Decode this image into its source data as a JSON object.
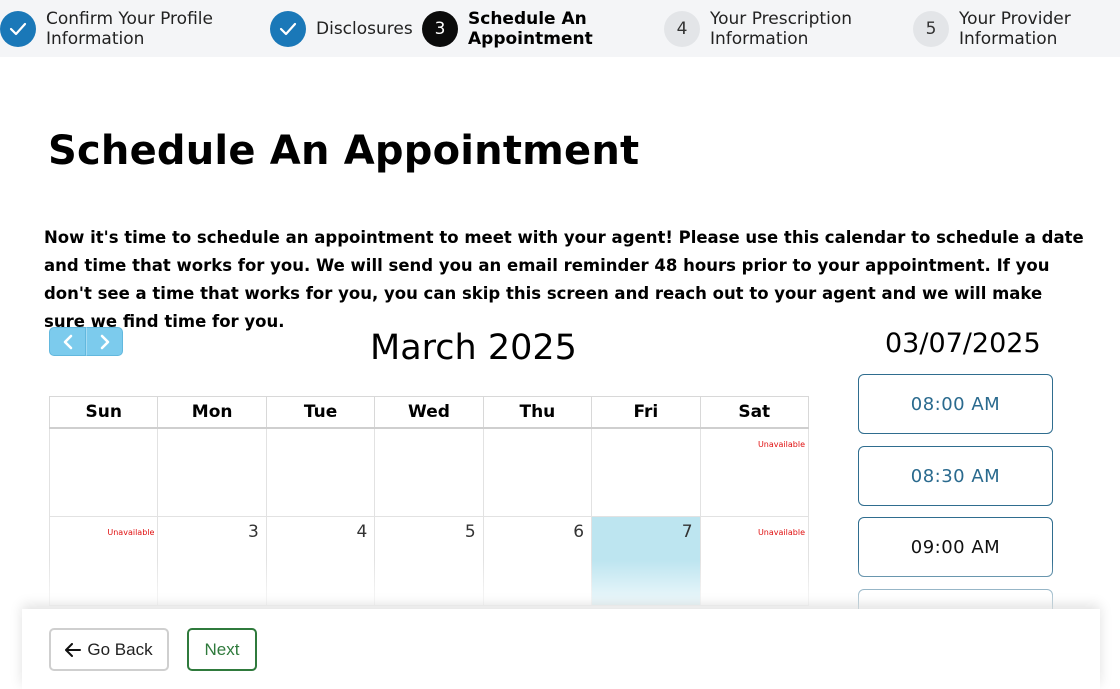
{
  "stepper": {
    "steps": [
      {
        "label": "Confirm Your Profile\nInformation",
        "state": "done",
        "number": ""
      },
      {
        "label": "Disclosures",
        "state": "done",
        "number": ""
      },
      {
        "label": "Schedule An\nAppointment",
        "state": "current",
        "number": "3"
      },
      {
        "label": "Your Prescription\nInformation",
        "state": "todo",
        "number": "4"
      },
      {
        "label": "Your Provider\nInformation",
        "state": "todo",
        "number": "5"
      }
    ]
  },
  "page": {
    "title": "Schedule An Appointment",
    "intro": "Now it's time to schedule an appointment to meet with your agent! Please use this calendar to schedule a date and time that works for you. We will send you an email reminder 48 hours prior to your appointment. If you don't see a time that works for you, you can skip this screen and reach out to your agent and we will make sure we find time for you."
  },
  "calendar": {
    "month_title": "March 2025",
    "weekdays": [
      "Sun",
      "Mon",
      "Tue",
      "Wed",
      "Thu",
      "Fri",
      "Sat"
    ],
    "unavailable_label": "Unavailable",
    "weeks": [
      [
        "",
        "",
        "",
        "",
        "",
        "",
        "U"
      ],
      [
        "U",
        "3",
        "4",
        "5",
        "6",
        "7",
        "U"
      ]
    ],
    "selected_day": "7"
  },
  "schedule": {
    "selected_date": "03/07/2025",
    "slots": [
      "08:00 AM",
      "08:30 AM",
      "09:00 AM"
    ]
  },
  "footer": {
    "back_label": "Go Back",
    "next_label": "Next"
  },
  "colors": {
    "accent_blue": "#1a78b8",
    "selected_day": "#bde5f0",
    "unavailable": "#e01010",
    "next_green": "#2f7a3c"
  }
}
